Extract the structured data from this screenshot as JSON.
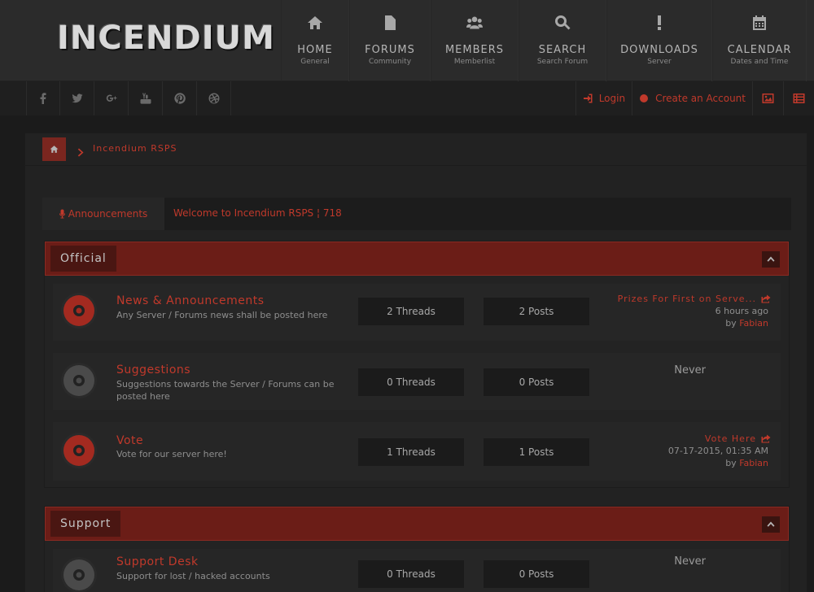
{
  "brand": {
    "logo_text": "INCENDIUM"
  },
  "nav": [
    {
      "title": "HOME",
      "sub": "General",
      "icon": "home-icon"
    },
    {
      "title": "FORUMS",
      "sub": "Community",
      "icon": "document-icon"
    },
    {
      "title": "MEMBERS",
      "sub": "Memberlist",
      "icon": "users-icon"
    },
    {
      "title": "SEARCH",
      "sub": "Search Forum",
      "icon": "search-icon"
    },
    {
      "title": "DOWNLOADS",
      "sub": "Server",
      "icon": "exclamation-icon"
    },
    {
      "title": "CALENDAR",
      "sub": "Dates and Time",
      "icon": "calendar-icon"
    }
  ],
  "social": [
    "facebook-icon",
    "twitter-icon",
    "google-plus-icon",
    "youtube-icon",
    "pinterest-icon",
    "dribbble-icon"
  ],
  "account": {
    "login": "Login",
    "register": "Create an Account"
  },
  "breadcrumb": {
    "current": "Incendium RSPS"
  },
  "announcement": {
    "tab": "Announcements",
    "text": "Welcome to Incendium RSPS ¦ 718"
  },
  "categories": [
    {
      "title": "Official",
      "forums": [
        {
          "name": "News & Announcements",
          "desc": "Any Server / Forums news shall be posted here",
          "threads": "2 Threads",
          "posts": "2 Posts",
          "last_title": "Prizes For First on Serve...",
          "last_date": "6 hours ago",
          "by": "by",
          "last_user": "Fabian",
          "status": "new"
        },
        {
          "name": "Suggestions",
          "desc": "Suggestions towards the Server / Forums can be posted here",
          "threads": "0 Threads",
          "posts": "0 Posts",
          "never": "Never",
          "status": "old"
        },
        {
          "name": "Vote",
          "desc": "Vote for our server here!",
          "threads": "1 Threads",
          "posts": "1 Posts",
          "last_title": "Vote Here",
          "last_date": "07-17-2015, 01:35 AM",
          "by": "by",
          "last_user": "Fabian",
          "status": "new"
        }
      ]
    },
    {
      "title": "Support",
      "forums": [
        {
          "name": "Support Desk",
          "desc": "Support for lost / hacked accounts",
          "threads": "0 Threads",
          "posts": "0 Posts",
          "never": "Never",
          "status": "old"
        }
      ]
    }
  ],
  "colors": {
    "accent": "#c0392b",
    "header_bg": "#2b2b2b",
    "category_bar": "#6b1d17"
  }
}
